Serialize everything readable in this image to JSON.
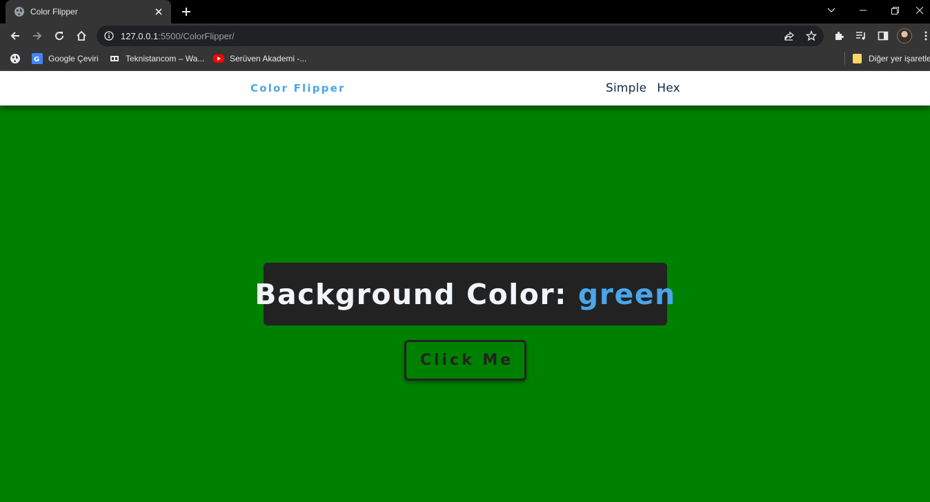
{
  "browser": {
    "tab_title": "Color Flipper",
    "url_host": "127.0.0.1",
    "url_rest": ":5500/ColorFlipper/",
    "bookmarks": [
      {
        "label": "Google Çeviri",
        "icon": "google-translate-icon"
      },
      {
        "label": "Teknistancom – Wa...",
        "icon": "teknistan-icon"
      },
      {
        "label": "Serüven Akademi -...",
        "icon": "youtube-icon"
      }
    ],
    "other_bookmarks": "Diğer yer işaretle"
  },
  "navbar": {
    "brand": "Color Flipper",
    "links": [
      "Simple",
      "Hex"
    ]
  },
  "main": {
    "label": "Background Color:",
    "color_value": "green",
    "button_label": "Click Me"
  },
  "colors": {
    "page_background": "#008000",
    "accent": "#49a6e9",
    "dark": "#222222",
    "nav_text": "#102a42"
  }
}
